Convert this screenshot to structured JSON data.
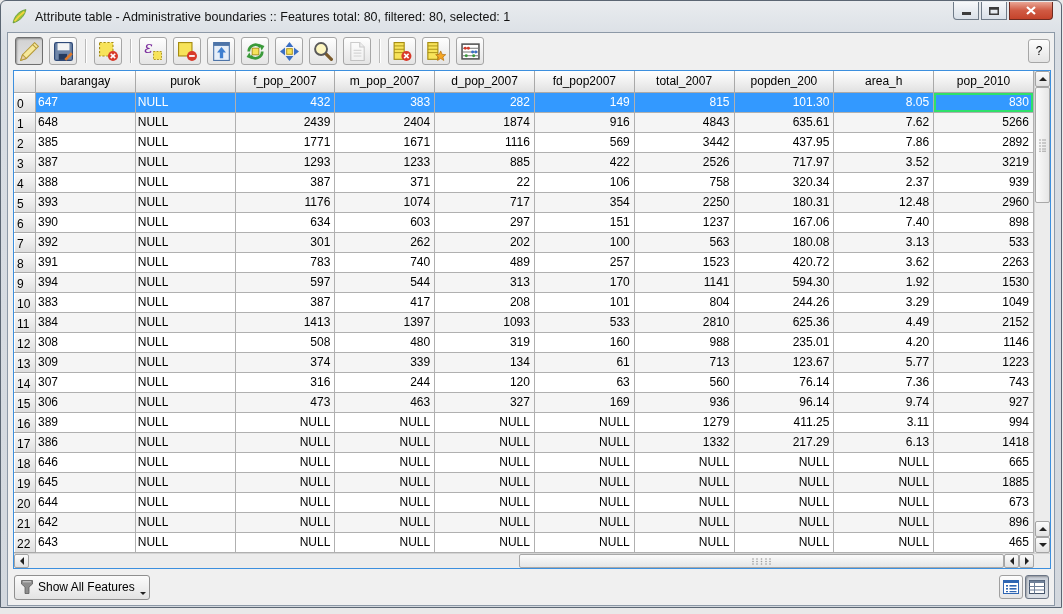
{
  "window": {
    "title": "Attribute table - Administrative boundaries :: Features total: 80, filtered: 80, selected: 1"
  },
  "toolbar": {
    "groups": [
      {
        "buttons": [
          {
            "kind": "pencil",
            "pressed": true,
            "disabled": false
          },
          {
            "kind": "floppy",
            "pressed": false,
            "disabled": false
          }
        ]
      },
      {
        "buttons": [
          {
            "kind": "square-x",
            "pressed": false,
            "disabled": false
          }
        ]
      },
      {
        "buttons": [
          {
            "kind": "expression",
            "symbol": "ε",
            "pressed": false,
            "disabled": false
          },
          {
            "kind": "square-minus",
            "pressed": false,
            "disabled": false
          },
          {
            "kind": "arrow-up",
            "pressed": false,
            "disabled": false
          },
          {
            "kind": "cycle",
            "pressed": false,
            "disabled": false
          },
          {
            "kind": "four-arrows",
            "pressed": false,
            "disabled": false
          },
          {
            "kind": "magnifier",
            "pressed": false,
            "disabled": false
          },
          {
            "kind": "page",
            "pressed": false,
            "disabled": true
          }
        ]
      },
      {
        "buttons": [
          {
            "kind": "column-x",
            "pressed": false,
            "disabled": false
          },
          {
            "kind": "column-star",
            "pressed": false,
            "disabled": false
          },
          {
            "kind": "abacus",
            "pressed": false,
            "disabled": false
          }
        ]
      }
    ],
    "help": "?"
  },
  "table": {
    "columns": [
      {
        "name": "barangay",
        "kind": "text",
        "current": false
      },
      {
        "name": "purok",
        "kind": "text",
        "current": false
      },
      {
        "name": "f_pop_2007",
        "kind": "number",
        "current": false
      },
      {
        "name": "m_pop_2007",
        "kind": "number",
        "current": false
      },
      {
        "name": "d_pop_2007",
        "kind": "number",
        "current": false
      },
      {
        "name": "fd_pop2007",
        "kind": "number",
        "current": false
      },
      {
        "name": "total_2007",
        "kind": "number",
        "current": false
      },
      {
        "name": "popden_200",
        "kind": "number",
        "current": false
      },
      {
        "name": "area_h",
        "kind": "number",
        "current": false
      },
      {
        "name": "pop_2010",
        "kind": "number",
        "current": true
      }
    ],
    "rows": [
      {
        "number": "0",
        "selected": true,
        "current": true,
        "cells": [
          "647",
          "NULL",
          "432",
          "383",
          "282",
          "149",
          "815",
          "101.30",
          "8.05",
          "830"
        ]
      },
      {
        "number": "1",
        "selected": false,
        "current": false,
        "cells": [
          "648",
          "NULL",
          "2439",
          "2404",
          "1874",
          "916",
          "4843",
          "635.61",
          "7.62",
          "5266"
        ]
      },
      {
        "number": "2",
        "selected": false,
        "current": false,
        "cells": [
          "385",
          "NULL",
          "1771",
          "1671",
          "1116",
          "569",
          "3442",
          "437.95",
          "7.86",
          "2892"
        ]
      },
      {
        "number": "3",
        "selected": false,
        "current": false,
        "cells": [
          "387",
          "NULL",
          "1293",
          "1233",
          "885",
          "422",
          "2526",
          "717.97",
          "3.52",
          "3219"
        ]
      },
      {
        "number": "4",
        "selected": false,
        "current": false,
        "cells": [
          "388",
          "NULL",
          "387",
          "371",
          "22",
          "106",
          "758",
          "320.34",
          "2.37",
          "939"
        ]
      },
      {
        "number": "5",
        "selected": false,
        "current": false,
        "cells": [
          "393",
          "NULL",
          "1176",
          "1074",
          "717",
          "354",
          "2250",
          "180.31",
          "12.48",
          "2960"
        ]
      },
      {
        "number": "6",
        "selected": false,
        "current": false,
        "cells": [
          "390",
          "NULL",
          "634",
          "603",
          "297",
          "151",
          "1237",
          "167.06",
          "7.40",
          "898"
        ]
      },
      {
        "number": "7",
        "selected": false,
        "current": false,
        "cells": [
          "392",
          "NULL",
          "301",
          "262",
          "202",
          "100",
          "563",
          "180.08",
          "3.13",
          "533"
        ]
      },
      {
        "number": "8",
        "selected": false,
        "current": false,
        "cells": [
          "391",
          "NULL",
          "783",
          "740",
          "489",
          "257",
          "1523",
          "420.72",
          "3.62",
          "2263"
        ]
      },
      {
        "number": "9",
        "selected": false,
        "current": false,
        "cells": [
          "394",
          "NULL",
          "597",
          "544",
          "313",
          "170",
          "1141",
          "594.30",
          "1.92",
          "1530"
        ]
      },
      {
        "number": "10",
        "selected": false,
        "current": false,
        "cells": [
          "383",
          "NULL",
          "387",
          "417",
          "208",
          "101",
          "804",
          "244.26",
          "3.29",
          "1049"
        ]
      },
      {
        "number": "11",
        "selected": false,
        "current": false,
        "cells": [
          "384",
          "NULL",
          "1413",
          "1397",
          "1093",
          "533",
          "2810",
          "625.36",
          "4.49",
          "2152"
        ]
      },
      {
        "number": "12",
        "selected": false,
        "current": false,
        "cells": [
          "308",
          "NULL",
          "508",
          "480",
          "319",
          "160",
          "988",
          "235.01",
          "4.20",
          "1146"
        ]
      },
      {
        "number": "13",
        "selected": false,
        "current": false,
        "cells": [
          "309",
          "NULL",
          "374",
          "339",
          "134",
          "61",
          "713",
          "123.67",
          "5.77",
          "1223"
        ]
      },
      {
        "number": "14",
        "selected": false,
        "current": false,
        "cells": [
          "307",
          "NULL",
          "316",
          "244",
          "120",
          "63",
          "560",
          "76.14",
          "7.36",
          "743"
        ]
      },
      {
        "number": "15",
        "selected": false,
        "current": false,
        "cells": [
          "306",
          "NULL",
          "473",
          "463",
          "327",
          "169",
          "936",
          "96.14",
          "9.74",
          "927"
        ]
      },
      {
        "number": "16",
        "selected": false,
        "current": false,
        "cells": [
          "389",
          "NULL",
          "NULL",
          "NULL",
          "NULL",
          "NULL",
          "1279",
          "411.25",
          "3.11",
          "994"
        ]
      },
      {
        "number": "17",
        "selected": false,
        "current": false,
        "cells": [
          "386",
          "NULL",
          "NULL",
          "NULL",
          "NULL",
          "NULL",
          "1332",
          "217.29",
          "6.13",
          "1418"
        ]
      },
      {
        "number": "18",
        "selected": false,
        "current": false,
        "cells": [
          "646",
          "NULL",
          "NULL",
          "NULL",
          "NULL",
          "NULL",
          "NULL",
          "NULL",
          "NULL",
          "665"
        ]
      },
      {
        "number": "19",
        "selected": false,
        "current": false,
        "cells": [
          "645",
          "NULL",
          "NULL",
          "NULL",
          "NULL",
          "NULL",
          "NULL",
          "NULL",
          "NULL",
          "1885"
        ]
      },
      {
        "number": "20",
        "selected": false,
        "current": false,
        "cells": [
          "644",
          "NULL",
          "NULL",
          "NULL",
          "NULL",
          "NULL",
          "NULL",
          "NULL",
          "NULL",
          "673"
        ]
      },
      {
        "number": "21",
        "selected": false,
        "current": false,
        "cells": [
          "642",
          "NULL",
          "NULL",
          "NULL",
          "NULL",
          "NULL",
          "NULL",
          "NULL",
          "NULL",
          "896"
        ]
      },
      {
        "number": "22",
        "selected": false,
        "current": false,
        "cells": [
          "643",
          "NULL",
          "NULL",
          "NULL",
          "NULL",
          "NULL",
          "NULL",
          "NULL",
          "NULL",
          "465"
        ]
      }
    ]
  },
  "bottom_bar": {
    "filter_button": "Show All Features",
    "view_buttons": [
      {
        "kind": "form",
        "selected": false
      },
      {
        "kind": "table",
        "selected": true
      }
    ]
  }
}
